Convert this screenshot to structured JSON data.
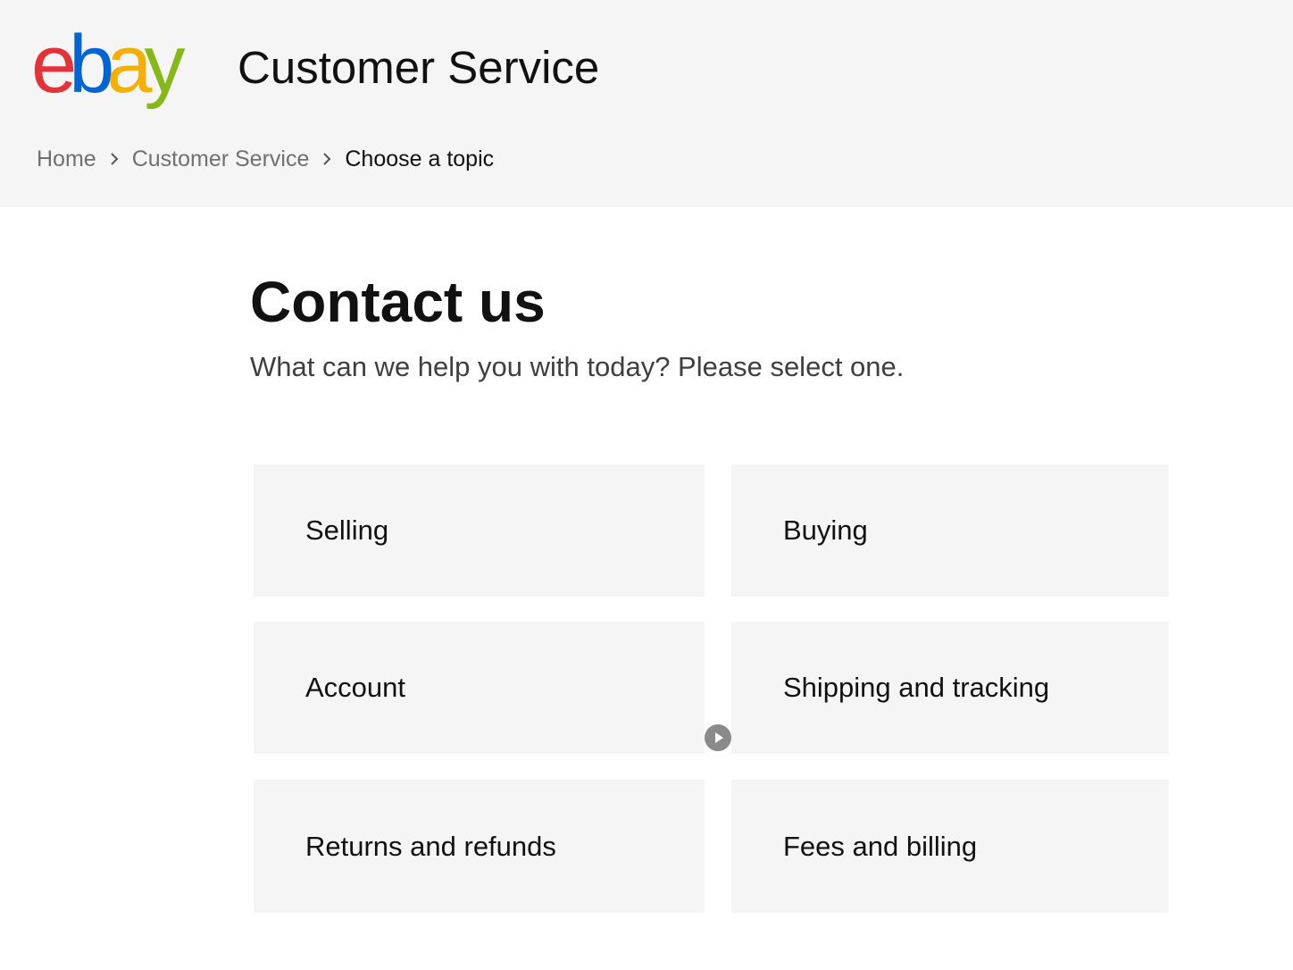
{
  "header": {
    "logo": {
      "letters": [
        {
          "char": "e",
          "color": "#e53238"
        },
        {
          "char": "b",
          "color": "#0064d2"
        },
        {
          "char": "a",
          "color": "#f5af02"
        },
        {
          "char": "y",
          "color": "#86b817"
        }
      ]
    },
    "title": "Customer Service"
  },
  "breadcrumb": {
    "items": [
      {
        "label": "Home"
      },
      {
        "label": "Customer Service"
      },
      {
        "label": "Choose a topic"
      }
    ]
  },
  "main": {
    "title": "Contact us",
    "subtitle": "What can we help you with today? Please select one.",
    "topics": [
      {
        "label": "Selling"
      },
      {
        "label": "Buying"
      },
      {
        "label": "Account"
      },
      {
        "label": "Shipping and tracking"
      },
      {
        "label": "Returns and refunds"
      },
      {
        "label": "Fees and billing"
      }
    ]
  },
  "icons": {
    "breadcrumb_separator": "chevron-right-icon",
    "play": "play-icon"
  }
}
